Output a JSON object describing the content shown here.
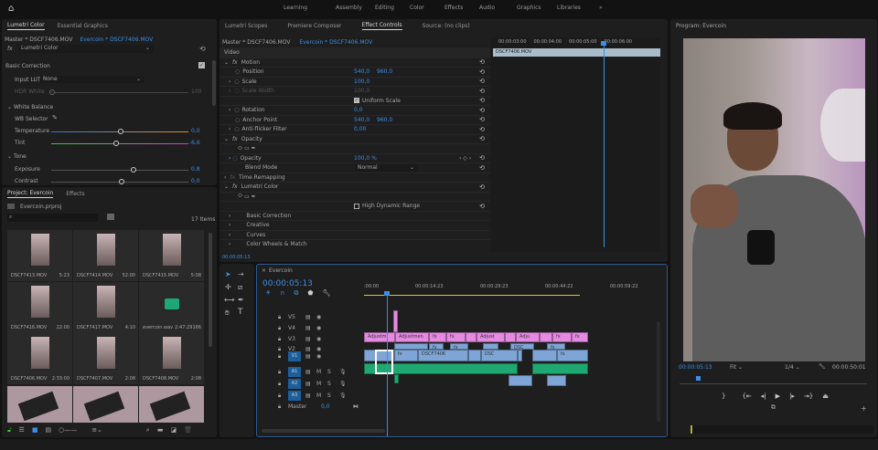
{
  "workspaces": [
    "Learning",
    "Assembly",
    "Editing",
    "Color",
    "Effects",
    "Audio",
    "Graphics",
    "Libraries"
  ],
  "workspaces_more": "»",
  "lumetri": {
    "tabs": [
      "Lumetri Color",
      "Essential Graphics"
    ],
    "master": "Master * DSCF7406.MOV",
    "sequence_clip": "Evercoin * DSCF7406.MOV",
    "effect": "Lumetri Color",
    "basic_correction": "Basic Correction",
    "input_lut_label": "Input LUT",
    "input_lut_value": "None",
    "hdr_white_label": "HDR White",
    "hdr_white_value": "100",
    "white_balance": "White Balance",
    "wb_selector": "WB Selector",
    "temperature_label": "Temperature",
    "temperature_value": "0,0",
    "tint_label": "Tint",
    "tint_value": "-6,6",
    "tone": "Tone",
    "exposure_label": "Exposure",
    "exposure_value": "0,8",
    "contrast_label": "Contrast",
    "contrast_value": "0,0"
  },
  "project": {
    "tabs": [
      "Project: Evercoin",
      "Effects"
    ],
    "file": "Evercoin.prproj",
    "search_placeholder": "",
    "items_count": "17 Items",
    "items": [
      {
        "name": "DSCF7413.MOV",
        "dur": "5:23"
      },
      {
        "name": "DSCF7414.MOV",
        "dur": "52:00"
      },
      {
        "name": "DSCF7415.MOV",
        "dur": "5:08"
      },
      {
        "name": "DSCF7416.MOV",
        "dur": "22:00"
      },
      {
        "name": "DSCF7417.MOV",
        "dur": "4:10"
      },
      {
        "name": "evercoin.wav",
        "dur": "2:47:29166"
      },
      {
        "name": "DSCF7406.MOV",
        "dur": "2:33:00"
      },
      {
        "name": "DSCF7407.MOV",
        "dur": "2:08"
      },
      {
        "name": "DSCF7408.MOV",
        "dur": "2:08"
      }
    ]
  },
  "effect_controls": {
    "tabs": [
      "Lumetri Scopes",
      "Premiere Composer",
      "Effect Controls",
      "Source: (no clips)"
    ],
    "master": "Master * DSCF7406.MOV",
    "sequence_clip": "Evercoin * DSCF7406.MOV",
    "video": "Video",
    "motion": "Motion",
    "position_label": "Position",
    "position_x": "540,0",
    "position_y": "960,0",
    "scale_label": "Scale",
    "scale_value": "100,0",
    "scale_width_label": "Scale Width",
    "scale_width_value": "100,0",
    "uniform_scale": "Uniform Scale",
    "rotation_label": "Rotation",
    "rotation_value": "0,0",
    "anchor_label": "Anchor Point",
    "anchor_x": "540,0",
    "anchor_y": "960,0",
    "antiflicker_label": "Anti-flicker Filter",
    "antiflicker_value": "0,00",
    "opacity_section": "Opacity",
    "opacity_label": "Opacity",
    "opacity_value": "100,0 %",
    "blend_label": "Blend Mode",
    "blend_value": "Normal",
    "time_remap": "Time Remapping",
    "lumetri": "Lumetri Color",
    "hdr": "High Dynamic Range",
    "sub": [
      "Basic Correction",
      "Creative",
      "Curves",
      "Color Wheels & Match"
    ],
    "ruler": [
      "00:00:03:00",
      "00:00:04:00",
      "00:00:05:00",
      "00:00:06:00"
    ],
    "clip_name": "DSCF7406.MOV",
    "timecode": "00:00:05:13"
  },
  "timeline": {
    "title": "Evercoin",
    "timecode": "00:00:05:13",
    "ruler": [
      ":00:00",
      "00:00:14:23",
      "00:00:29:23",
      "00:00:44:22",
      "00:00:59:22"
    ],
    "video_tracks": [
      "V5",
      "V4",
      "V3",
      "V2",
      "V1"
    ],
    "audio_tracks": [
      "A1",
      "A2",
      "A3"
    ],
    "master_label": "Master",
    "master_value": "0,0",
    "mute": "M",
    "solo": "S",
    "clips": {
      "adj1": "Adjustm",
      "adj2": "Adjustmen",
      "adj3": "Adjust",
      "adj4": "Adju",
      "v1a": "DSCF7406",
      "v1b": "DSC",
      "v2a": "DSC",
      "fx": "fx"
    }
  },
  "program": {
    "title": "Program: Evercoin",
    "timecode": "00:00:05:13",
    "fit": "Fit",
    "resolution": "1/4",
    "duration": "00:00:50:01"
  },
  "colors": {
    "accent": "#3d8ee6",
    "pink": "#e48ae0",
    "clipblue": "#7ea5d6",
    "audio": "#1fa871"
  }
}
